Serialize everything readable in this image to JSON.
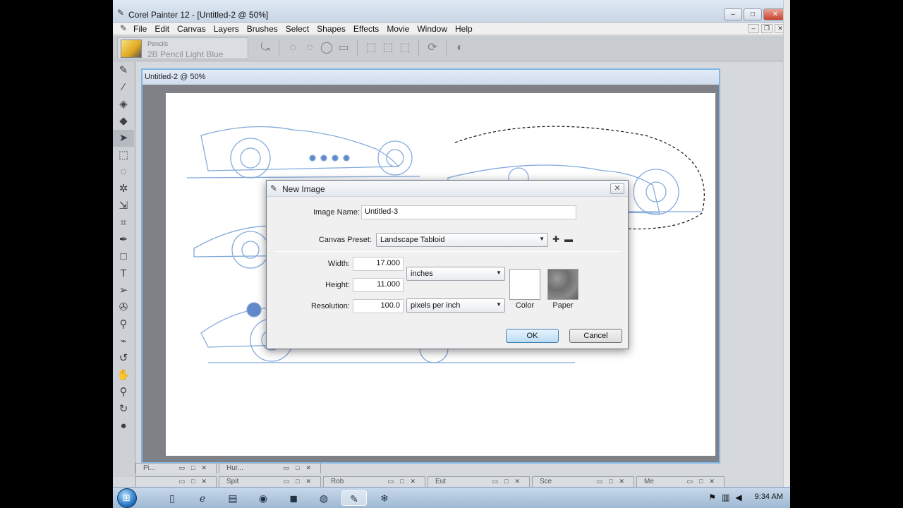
{
  "app": {
    "title": "Corel Painter 12 - [Untitled-2 @ 50%]",
    "icon": "painter-icon"
  },
  "window_buttons": {
    "minimize": "▭",
    "maximize": "□",
    "close": "✕"
  },
  "menu": {
    "items": [
      "File",
      "Edit",
      "Canvas",
      "Layers",
      "Brushes",
      "Select",
      "Shapes",
      "Effects",
      "Movie",
      "Window",
      "Help"
    ]
  },
  "propbar": {
    "brush_category": "Pencils",
    "brush_variant": "2B Pencil Light Blue"
  },
  "document": {
    "title": "Untitled-2 @ 50%"
  },
  "dialog": {
    "title": "New Image",
    "close_label": "✕",
    "image_name_label": "Image Name:",
    "image_name_value": "Untitled-3",
    "canvas_preset_label": "Canvas Preset:",
    "canvas_preset_value": "Landscape Tabloid",
    "width_label": "Width:",
    "width_value": "17.000",
    "height_label": "Height:",
    "height_value": "11.000",
    "resolution_label": "Resolution:",
    "resolution_value": "100.0",
    "size_unit": "inches",
    "resolution_unit": "pixels per inch",
    "color_label": "Color",
    "paper_label": "Paper",
    "ok_label": "OK",
    "cancel_label": "Cancel"
  },
  "minimized_windows": {
    "row1": [
      {
        "title": "Pi..."
      },
      {
        "title": "Hur..."
      }
    ],
    "row2": [
      {
        "title": ""
      },
      {
        "title": "Spit"
      },
      {
        "title": "Rob"
      },
      {
        "title": "Eut"
      },
      {
        "title": "Sce"
      },
      {
        "title": "Me"
      }
    ]
  },
  "taskbar": {
    "clock": "9:34 AM",
    "apps": [
      "explorer-icon",
      "ie-icon",
      "folder-icon",
      "chrome-icon",
      "app-cube-icon",
      "firefox-icon",
      "painter-icon",
      "snowflake-icon"
    ]
  }
}
